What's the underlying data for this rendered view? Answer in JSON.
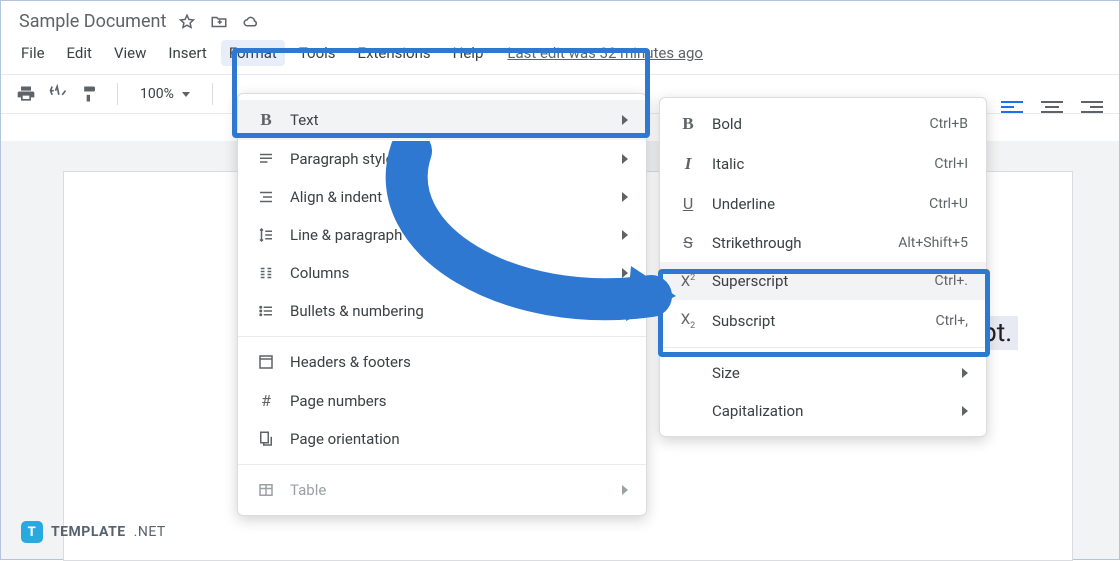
{
  "title": "Sample Document",
  "menubar": {
    "file": "File",
    "edit": "Edit",
    "view": "View",
    "insert": "Insert",
    "format": "Format",
    "tools": "Tools",
    "extensions": "Extensions",
    "help": "Help",
    "last_edit": "Last edit was 32 minutes ago"
  },
  "toolbar": {
    "zoom": "100%"
  },
  "format_menu": {
    "text": "Text",
    "paragraph_styles": "Paragraph styles",
    "align_indent": "Align & indent",
    "line_paragraph_spacing": "Line & paragraph spacing",
    "columns": "Columns",
    "bullets_numbering": "Bullets & numbering",
    "headers_footers": "Headers & footers",
    "page_numbers": "Page numbers",
    "page_orientation": "Page orientation",
    "table": "Table"
  },
  "text_submenu": {
    "bold": {
      "label": "Bold",
      "shortcut": "Ctrl+B"
    },
    "italic": {
      "label": "Italic",
      "shortcut": "Ctrl+I"
    },
    "underline": {
      "label": "Underline",
      "shortcut": "Ctrl+U"
    },
    "strikethrough": {
      "label": "Strikethrough",
      "shortcut": "Alt+Shift+5"
    },
    "superscript": {
      "label": "Superscript",
      "shortcut": "Ctrl+."
    },
    "subscript": {
      "label": "Subscript",
      "shortcut": "Ctrl+,"
    },
    "size": "Size",
    "capitalization": "Capitalization"
  },
  "page_text": {
    "visible_word": "script."
  },
  "brand": {
    "name": "TEMPLATE",
    "suffix": ".NET",
    "logo_letter": "T"
  }
}
